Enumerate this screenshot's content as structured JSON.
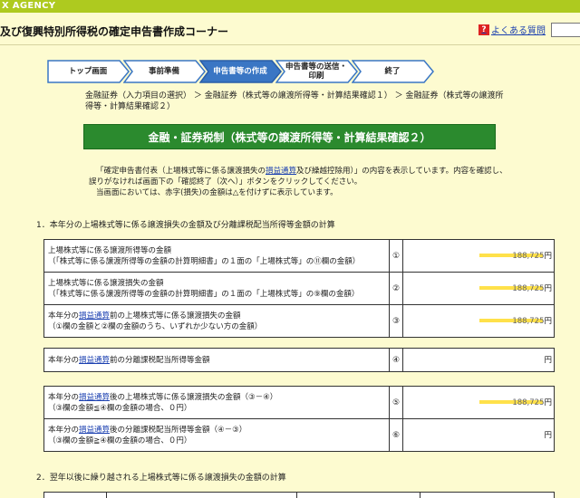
{
  "header": {
    "agency": "X AGENCY",
    "title": "及び復興特別所得税の確定申告書作成コーナー",
    "faq_label": "よくある質問",
    "help_icon": "?"
  },
  "steps": [
    {
      "label": "トップ画面",
      "active": false
    },
    {
      "label": "事前準備",
      "active": false
    },
    {
      "label": "申告書等の作成",
      "active": true
    },
    {
      "label": "申告書等の送信・印刷",
      "active": false
    },
    {
      "label": "終了",
      "active": false
    }
  ],
  "breadcrumb": "金融証券（入力項目の選択） ＞ 金融証券（株式等の譲渡所得等・計算結果確認１） ＞ 金融証券（株式等の譲渡所得等・計算結果確認２）",
  "section_title": "金融・証券税制（株式等の譲渡所得等・計算結果確認２）",
  "intro": {
    "line1_pre": "「確定申告書付表（上場株式等に係る譲渡損失の",
    "line1_link": "損益通算",
    "line1_post": "及び繰越控除用）」の内容を表示しています。内容を確認し、",
    "line2": "誤りがなければ画面下の「確認終了（次へ）」ボタンをクリックしてください。",
    "line3": "当画面においては、赤字(損失)の金額は△を付けずに表示しています。"
  },
  "section1_title": "1．本年分の上場株式等に係る譲渡損失の金額及び分離課税配当所得等金額の計算",
  "section2_title": "2．翌年以後に繰り越される上場株式等に係る譲渡損失の金額の計算",
  "link_word": "損益通算",
  "unit": "円",
  "rows": {
    "r1": {
      "line1": "上場株式等に係る譲渡所得等の金額",
      "line2": "（「株式等に係る譲渡所得等の金額の計算明細書」の１面の「上場株式等」の⑪欄の金額）",
      "num": "①",
      "amount": "188,725"
    },
    "r2": {
      "line1": "上場株式等に係る譲渡損失の金額",
      "line2": "（「株式等に係る譲渡所得等の金額の計算明細書」の１面の「上場株式等」の⑨欄の金額）",
      "num": "②",
      "amount": "188,725"
    },
    "r3": {
      "line1_pre": "本年分の",
      "line1_post": "前の上場株式等に係る譲渡損失の金額",
      "line2": "（①欄の金額と②欄の金額のうち、いずれか少ない方の金額）",
      "num": "③",
      "amount": "188,725"
    },
    "r4": {
      "line1_pre": "本年分の",
      "line1_post": "前の分離課税配当所得等金額",
      "num": "④",
      "amount": ""
    },
    "r5": {
      "line1_pre": "本年分の",
      "line1_post": "後の上場株式等に係る譲渡損失の金額（③－④）",
      "line2": "（③欄の金額≦④欄の金額の場合、０円）",
      "num": "⑤",
      "amount": "188,725"
    },
    "r6": {
      "line1_pre": "本年分の",
      "line1_post": "後の分離課税配当所得等金額（④－③）",
      "line2": "（③欄の金額≧④欄の金額の場合、０円）",
      "num": "⑥",
      "amount": ""
    }
  },
  "colors": {
    "agency_bar": "#aeca1f",
    "background": "#fdfbd0",
    "section_header": "#2b8a2e",
    "step_active": "#3a76c4",
    "step_border": "#3a76c4",
    "link": "#1a3fb0",
    "highlight": "#ffe14a"
  }
}
